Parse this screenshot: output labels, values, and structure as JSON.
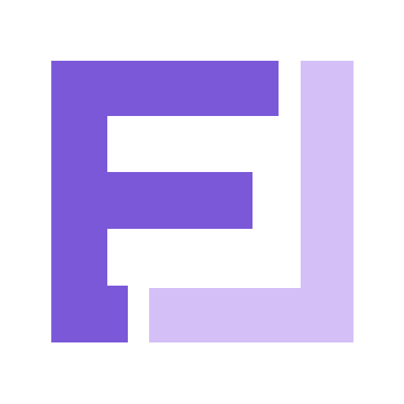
{
  "logo": {
    "icon": "fj-monogram-logo-icon",
    "letters": "FJ",
    "colors": {
      "background": "#ffffff",
      "primary": "#7a58d8",
      "secondary": "#d4bff7"
    }
  }
}
